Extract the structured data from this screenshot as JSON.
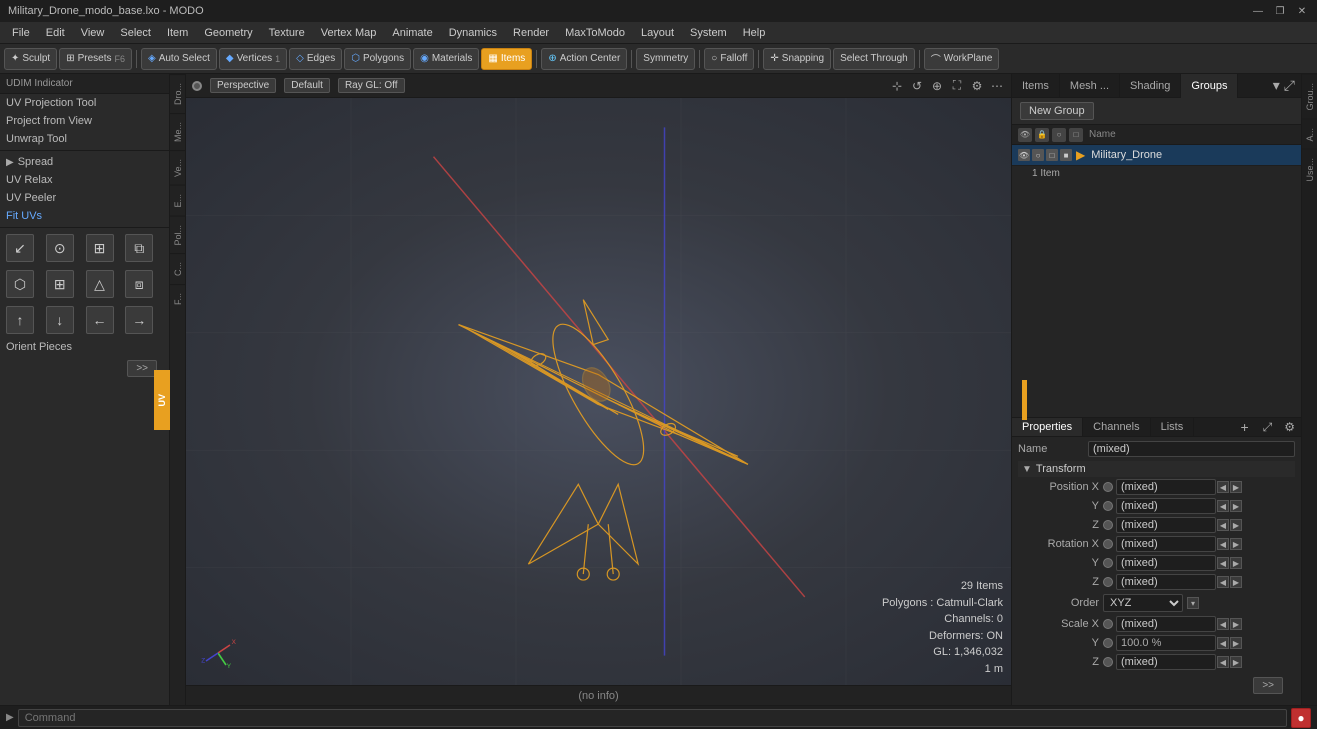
{
  "titlebar": {
    "title": "Military_Drone_modo_base.lxo - MODO",
    "min": "—",
    "max": "❐",
    "close": "✕"
  },
  "menubar": {
    "items": [
      "File",
      "Edit",
      "View",
      "Select",
      "Item",
      "Geometry",
      "Texture",
      "Vertex Map",
      "Animate",
      "Dynamics",
      "Render",
      "MaxToModo",
      "Layout",
      "System",
      "Help"
    ]
  },
  "toolbar": {
    "sculpt": "Sculpt",
    "presets": "Presets",
    "presets_key": "F6",
    "auto_select": "Auto Select",
    "vertices": "Vertices",
    "vertices_num": "1",
    "edges": "Edges",
    "polygons": "Polygons",
    "materials": "Materials",
    "items": "Items",
    "action_center": "Action Center",
    "symmetry": "Symmetry",
    "falloff": "Falloff",
    "snapping": "Snapping",
    "select_through": "Select Through",
    "workplane": "WorkPlane"
  },
  "left_panel": {
    "header": "UDIM Indicator",
    "tools": [
      "UV Projection Tool",
      "Project from View",
      "Unwrap Tool"
    ],
    "spread": "Spread",
    "uv_relax": "UV Relax",
    "uv_peeler": "UV Peeler",
    "fit_uvs": "Fit UVs",
    "orient_label": "Orient Pieces",
    "more_btn": ">>"
  },
  "side_tabs": [
    "UV",
    "Dro...",
    "Me...",
    "Ve...",
    "E...",
    "Pol...",
    "C..."
  ],
  "viewport": {
    "mode": "Perspective",
    "shading": "Default",
    "raygl": "Ray GL: Off",
    "stats": {
      "items": "29 Items",
      "polygons": "Polygons : Catmull-Clark",
      "channels": "Channels: 0",
      "deformers": "Deformers: ON",
      "gl": "GL: 1,346,032",
      "scale": "1 m"
    },
    "status": "(no info)"
  },
  "right_panel": {
    "tabs": [
      "Items",
      "Mesh ...",
      "Shading",
      "Groups"
    ],
    "new_group_btn": "New Group",
    "table_headers": {
      "name": "Name"
    },
    "item": {
      "name": "Military_Drone",
      "count": "1 Item"
    }
  },
  "properties": {
    "tabs": [
      "Properties",
      "Channels",
      "Lists"
    ],
    "add_btn": "+",
    "name_label": "Name",
    "name_value": "(mixed)",
    "transform_label": "Transform",
    "position": {
      "x_label": "Position X",
      "x_value": "(mixed)",
      "y_label": "Y",
      "y_value": "(mixed)",
      "z_label": "Z",
      "z_value": "(mixed)"
    },
    "rotation": {
      "x_label": "Rotation X",
      "x_value": "(mixed)",
      "y_label": "Y",
      "y_value": "(mixed)",
      "z_label": "Z",
      "z_value": "(mixed)"
    },
    "order": {
      "label": "Order",
      "value": "XYZ"
    },
    "scale": {
      "x_label": "Scale X",
      "x_value": "(mixed)",
      "y_label": "Y",
      "y_value": "100.0 %",
      "z_label": "Z",
      "z_value": "(mixed)"
    }
  },
  "right_side_tabs": [
    "Grou...",
    "A...",
    "Use..."
  ],
  "command_bar": {
    "placeholder": "Command",
    "exec_btn": "●"
  },
  "colors": {
    "active_tab": "#e8a020",
    "selected_item": "#1a3a5a",
    "drone_color": "#e8a020"
  }
}
